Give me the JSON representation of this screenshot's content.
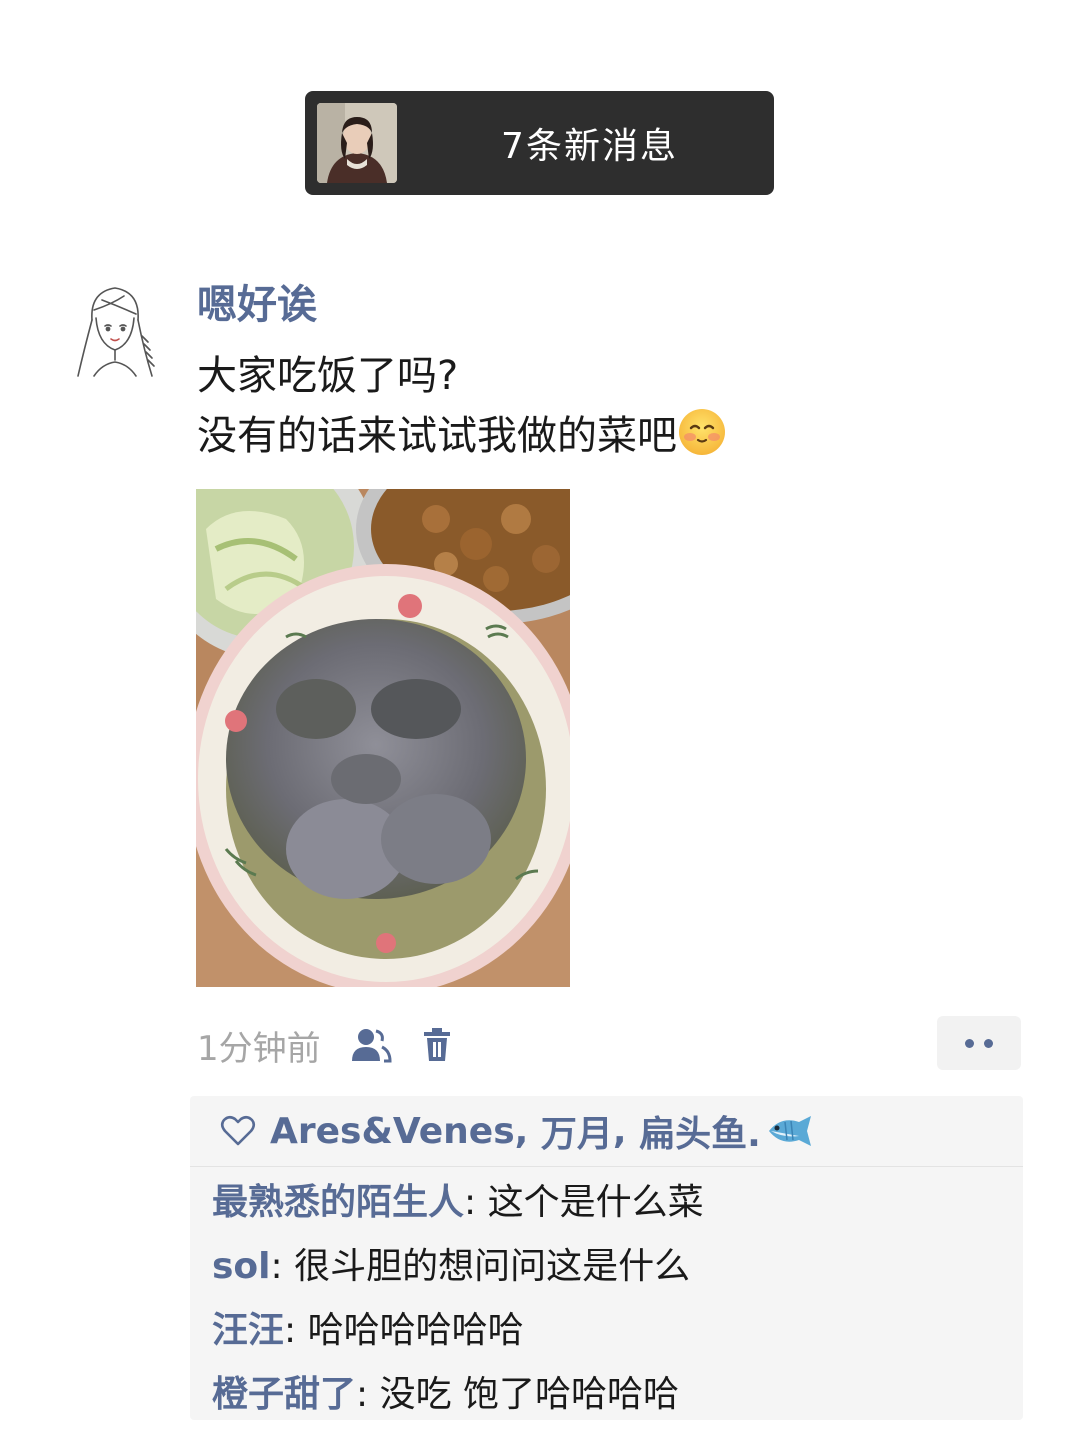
{
  "new_messages": {
    "label": "7条新消息"
  },
  "post": {
    "nickname": "嗯好诶",
    "text_line1": "大家吃饭了吗?",
    "text_line2": "没有的话来试试我做的菜吧",
    "emoji": "smiling-face-with-hearts-emoji",
    "time": "1分钟前"
  },
  "likes": {
    "icon": "heart-outline-icon",
    "names": [
      "Ares&Venes",
      "万月",
      "扁头鱼."
    ],
    "separator": ", ",
    "trailing_emoji": "fish-emoji"
  },
  "comments": [
    {
      "name": "最熟悉的陌生人",
      "text": "这个是什么菜"
    },
    {
      "name": "sol",
      "text": "很斗胆的想问问这是什么"
    },
    {
      "name": "汪汪",
      "text": "哈哈哈哈哈哈"
    },
    {
      "name": "橙子甜了",
      "text": "没吃 饱了哈哈哈哈"
    }
  ],
  "colors": {
    "link": "#576b95",
    "time": "#a6a6a6",
    "pill": "#2e2e2e",
    "panel": "#f5f5f5"
  }
}
